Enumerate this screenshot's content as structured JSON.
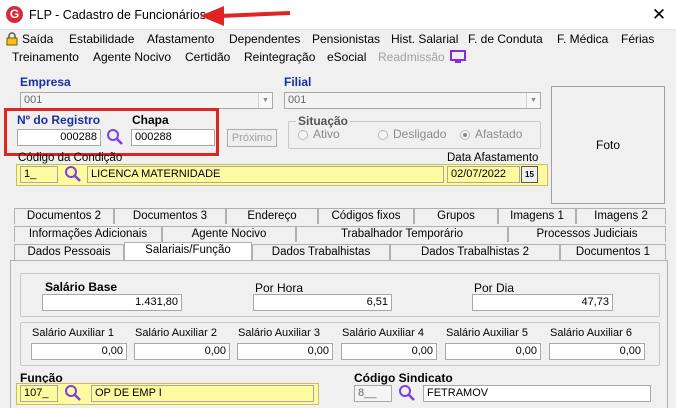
{
  "window": {
    "title": "FLP - Cadastro de Funcionários",
    "close_glyph": "✕",
    "icon_letter": "G"
  },
  "menu": {
    "row1": [
      "Saída",
      "Estabilidade",
      "Afastamento",
      "Dependentes",
      "Pensionistas",
      "Hist. Salarial",
      "F. de Conduta",
      "F. Médica",
      "Férias"
    ],
    "row2": [
      "Treinamento",
      "Agente Nocivo",
      "Certidão",
      "Reintegração",
      "eSocial",
      "Readmissão"
    ]
  },
  "empresa": {
    "label": "Empresa",
    "value": "001"
  },
  "filial": {
    "label": "Filial",
    "value": "001"
  },
  "registro": {
    "label": "Nº do Registro",
    "value": "000288"
  },
  "chapa": {
    "label": "Chapa",
    "value": "000288"
  },
  "proximo_label": "Próximo",
  "situacao": {
    "label": "Situação",
    "options": [
      "Ativo",
      "Desligado",
      "Afastado"
    ],
    "selected": "Afastado"
  },
  "foto_label": "Foto",
  "condicao": {
    "label": "Código da Condição",
    "code": "1_",
    "description": "LICENCA MATERNIDADE"
  },
  "data_afastamento": {
    "label": "Data Afastamento",
    "value": "02/07/2022",
    "button": "15"
  },
  "tabs": {
    "row1": [
      "Documentos 2",
      "Documentos 3",
      "Endereço",
      "Códigos fixos",
      "Grupos",
      "Imagens 1",
      "Imagens 2"
    ],
    "row2": [
      "Informações Adicionais",
      "Agente Nocivo",
      "Trabalhador Temporário",
      "Processos Judiciais"
    ],
    "row3": [
      "Dados Pessoais",
      "Salariais/Função",
      "Dados Trabalhistas",
      "Dados Trabalhistas 2",
      "Documentos 1"
    ],
    "active": "Salariais/Função"
  },
  "salario": {
    "base_label": "Salário Base",
    "base_value": "1.431,80",
    "hora_label": "Por Hora",
    "hora_value": "6,51",
    "dia_label": "Por Dia",
    "dia_value": "47,73"
  },
  "aux": [
    {
      "label": "Salário Auxiliar 1",
      "value": "0,00"
    },
    {
      "label": "Salário Auxiliar 2",
      "value": "0,00"
    },
    {
      "label": "Salário Auxiliar 3",
      "value": "0,00"
    },
    {
      "label": "Salário Auxiliar 4",
      "value": "0,00"
    },
    {
      "label": "Salário Auxiliar 5",
      "value": "0,00"
    },
    {
      "label": "Salário Auxiliar 6",
      "value": "0,00"
    }
  ],
  "funcao": {
    "label": "Função",
    "code": "107_",
    "description": "OP DE EMP I"
  },
  "sindicato": {
    "label": "Código Sindicato",
    "code": "8__",
    "description": "FETRAMOV"
  },
  "colors": {
    "highlight": "#e02424",
    "yellow_field": "#fdfaa0",
    "label_blue": "#1a2f9c",
    "lens": "#7b3fe4"
  }
}
